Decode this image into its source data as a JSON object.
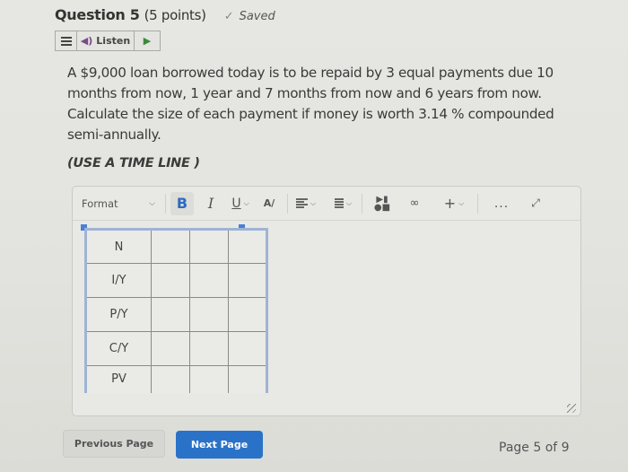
{
  "header": {
    "question_title": "Question 5",
    "points": "(5 points)",
    "saved_label": "Saved"
  },
  "listen_bar": {
    "menu_icon": "menu-icon",
    "listen_label": "Listen",
    "play_icon": "play-icon"
  },
  "question": {
    "text": "A $9,000 loan borrowed today is to be repaid by 3 equal payments due 10 months from now, 1 year and 7 months from now and 6 years from now. Calculate the size of each payment if money is worth 3.14 % compounded semi-annually.",
    "instruction": "(USE A TIME LINE )"
  },
  "editor": {
    "toolbar": {
      "format_label": "Format",
      "bold_label": "B",
      "italic_label": "I",
      "underline_label": "U",
      "strike_label": "A/",
      "more_label": "...",
      "plus_label": "+"
    },
    "table": {
      "rows": [
        {
          "label": "N",
          "cells": [
            "",
            "",
            ""
          ]
        },
        {
          "label": "I/Y",
          "cells": [
            "",
            "",
            ""
          ]
        },
        {
          "label": "P/Y",
          "cells": [
            "",
            "",
            ""
          ]
        },
        {
          "label": "C/Y",
          "cells": [
            "",
            "",
            ""
          ]
        },
        {
          "label": "PV",
          "cells": [
            "",
            "",
            ""
          ]
        }
      ]
    }
  },
  "navigation": {
    "previous_label": "Previous Page",
    "next_label": "Next Page",
    "page_info": "Page 5 of 9"
  },
  "colors": {
    "accent": "#2a72c8",
    "bold_active": "#2d6bc0",
    "table_selection": "#4a7fd6",
    "play_green": "#3a8a3a"
  }
}
